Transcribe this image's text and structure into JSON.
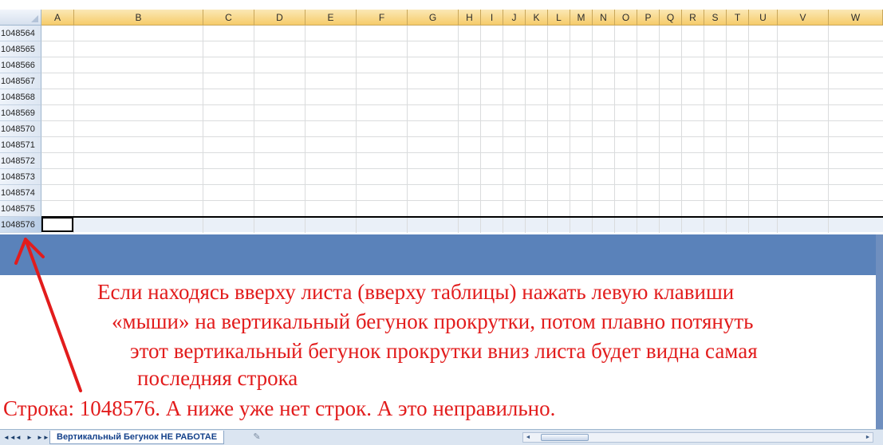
{
  "columns": [
    "A",
    "B",
    "C",
    "D",
    "E",
    "F",
    "G",
    "H",
    "I",
    "J",
    "K",
    "L",
    "M",
    "N",
    "O",
    "P",
    "Q",
    "R",
    "S",
    "T",
    "U",
    "V",
    "W"
  ],
  "rows": [
    "1048564",
    "1048565",
    "1048566",
    "1048567",
    "1048568",
    "1048569",
    "1048570",
    "1048571",
    "1048572",
    "1048573",
    "1048574",
    "1048575",
    "1048576"
  ],
  "selected_row": "1048576",
  "message": {
    "line1": "Если находясь вверху листа (вверху таблицы) нажать левую клавиши",
    "line2": "«мыши» на вертикальный бегунок прокрутки, потом плавно потянуть",
    "line3": "этот вертикальный бегунок прокрутки вниз листа будет видна самая",
    "line4": "последняя строка",
    "line5": "Строка: 1048576. А ниже уже нет строк. А это неправильно."
  },
  "sheet_tab": "Вертикальный Бегунок НЕ РАБОТАЕ",
  "nav": [
    "◄◄",
    "◄",
    "►",
    "►►"
  ],
  "colors": {
    "annotation": "#e21c1c",
    "band": "#5a82ba",
    "col_header": "#f6cc6a"
  }
}
